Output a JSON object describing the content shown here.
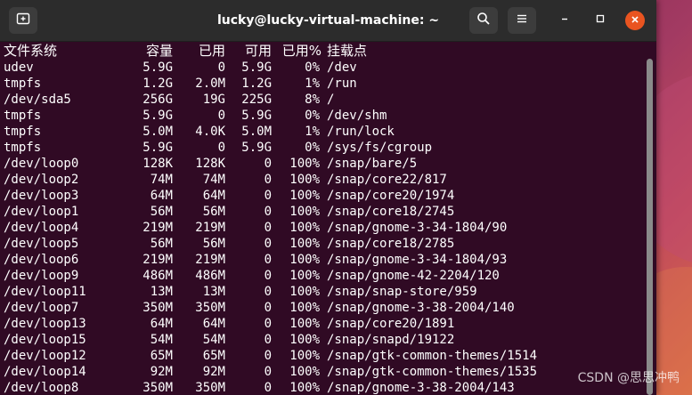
{
  "window": {
    "title": "lucky@lucky-virtual-machine: ~",
    "icons": {
      "new_tab": "new-tab-icon",
      "search": "search-icon",
      "menu": "hamburger-menu-icon",
      "minimize": "minimize-icon",
      "maximize": "maximize-icon",
      "close": "close-icon"
    },
    "close_color": "#e95420"
  },
  "terminal": {
    "background": "#300a24",
    "header": {
      "filesystem": "文件系统",
      "size": "容量",
      "used": "已用",
      "avail": "可用",
      "use_pct": "已用%",
      "mount": "挂载点"
    },
    "rows": [
      {
        "fs": "udev",
        "size": "5.9G",
        "used": "0",
        "avail": "5.9G",
        "pct": "0%",
        "mount": "/dev"
      },
      {
        "fs": "tmpfs",
        "size": "1.2G",
        "used": "2.0M",
        "avail": "1.2G",
        "pct": "1%",
        "mount": "/run"
      },
      {
        "fs": "/dev/sda5",
        "size": "256G",
        "used": "19G",
        "avail": "225G",
        "pct": "8%",
        "mount": "/"
      },
      {
        "fs": "tmpfs",
        "size": "5.9G",
        "used": "0",
        "avail": "5.9G",
        "pct": "0%",
        "mount": "/dev/shm"
      },
      {
        "fs": "tmpfs",
        "size": "5.0M",
        "used": "4.0K",
        "avail": "5.0M",
        "pct": "1%",
        "mount": "/run/lock"
      },
      {
        "fs": "tmpfs",
        "size": "5.9G",
        "used": "0",
        "avail": "5.9G",
        "pct": "0%",
        "mount": "/sys/fs/cgroup"
      },
      {
        "fs": "/dev/loop0",
        "size": "128K",
        "used": "128K",
        "avail": "0",
        "pct": "100%",
        "mount": "/snap/bare/5"
      },
      {
        "fs": "/dev/loop2",
        "size": "74M",
        "used": "74M",
        "avail": "0",
        "pct": "100%",
        "mount": "/snap/core22/817"
      },
      {
        "fs": "/dev/loop3",
        "size": "64M",
        "used": "64M",
        "avail": "0",
        "pct": "100%",
        "mount": "/snap/core20/1974"
      },
      {
        "fs": "/dev/loop1",
        "size": "56M",
        "used": "56M",
        "avail": "0",
        "pct": "100%",
        "mount": "/snap/core18/2745"
      },
      {
        "fs": "/dev/loop4",
        "size": "219M",
        "used": "219M",
        "avail": "0",
        "pct": "100%",
        "mount": "/snap/gnome-3-34-1804/90"
      },
      {
        "fs": "/dev/loop5",
        "size": "56M",
        "used": "56M",
        "avail": "0",
        "pct": "100%",
        "mount": "/snap/core18/2785"
      },
      {
        "fs": "/dev/loop6",
        "size": "219M",
        "used": "219M",
        "avail": "0",
        "pct": "100%",
        "mount": "/snap/gnome-3-34-1804/93"
      },
      {
        "fs": "/dev/loop9",
        "size": "486M",
        "used": "486M",
        "avail": "0",
        "pct": "100%",
        "mount": "/snap/gnome-42-2204/120"
      },
      {
        "fs": "/dev/loop11",
        "size": "13M",
        "used": "13M",
        "avail": "0",
        "pct": "100%",
        "mount": "/snap/snap-store/959"
      },
      {
        "fs": "/dev/loop7",
        "size": "350M",
        "used": "350M",
        "avail": "0",
        "pct": "100%",
        "mount": "/snap/gnome-3-38-2004/140"
      },
      {
        "fs": "/dev/loop13",
        "size": "64M",
        "used": "64M",
        "avail": "0",
        "pct": "100%",
        "mount": "/snap/core20/1891"
      },
      {
        "fs": "/dev/loop15",
        "size": "54M",
        "used": "54M",
        "avail": "0",
        "pct": "100%",
        "mount": "/snap/snapd/19122"
      },
      {
        "fs": "/dev/loop12",
        "size": "65M",
        "used": "65M",
        "avail": "0",
        "pct": "100%",
        "mount": "/snap/gtk-common-themes/1514"
      },
      {
        "fs": "/dev/loop14",
        "size": "92M",
        "used": "92M",
        "avail": "0",
        "pct": "100%",
        "mount": "/snap/gtk-common-themes/1535"
      },
      {
        "fs": "/dev/loop8",
        "size": "350M",
        "used": "350M",
        "avail": "0",
        "pct": "100%",
        "mount": "/snap/gnome-3-38-2004/143"
      }
    ]
  },
  "watermark": "CSDN @思思冲鸭"
}
